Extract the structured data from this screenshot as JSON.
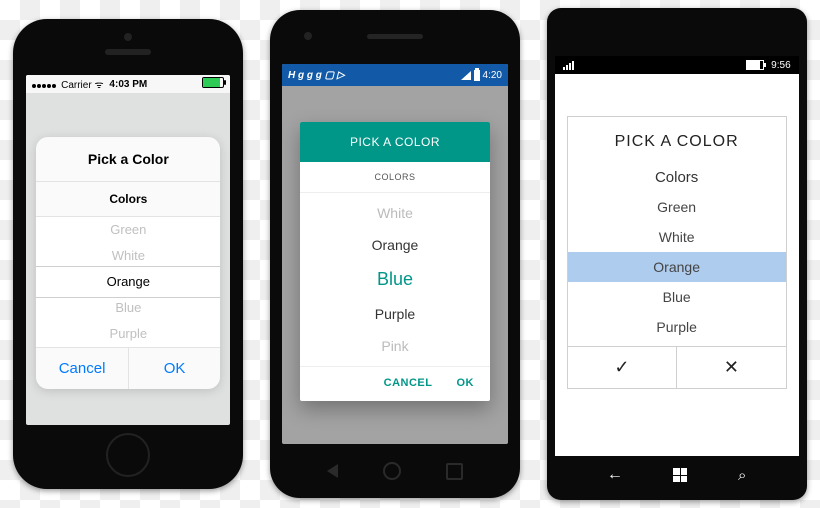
{
  "ios": {
    "status": {
      "carrier": "Carrier",
      "wifi": "ᯤ",
      "time": "4:03 PM"
    },
    "dialog": {
      "title": "Pick a Color",
      "subtitle": "Colors",
      "options": [
        "Green",
        "White",
        "Orange",
        "Blue",
        "Purple"
      ],
      "selected": "Orange",
      "cancel": "Cancel",
      "ok": "OK"
    }
  },
  "android": {
    "status": {
      "icons_left": "H g g g ▢ ▷",
      "time": "4:20"
    },
    "dialog": {
      "title": "PICK A COLOR",
      "subtitle": "COLORS",
      "options": [
        "White",
        "Orange",
        "Blue",
        "Purple",
        "Pink"
      ],
      "selected": "Blue",
      "cancel": "CANCEL",
      "ok": "OK"
    }
  },
  "windows": {
    "status": {
      "time": "9:56"
    },
    "dialog": {
      "title": "PICK A COLOR",
      "subtitle": "Colors",
      "options": [
        "Green",
        "White",
        "Orange",
        "Blue",
        "Purple"
      ],
      "selected": "Orange",
      "ok_icon": "✓",
      "cancel_icon": "✕"
    }
  }
}
